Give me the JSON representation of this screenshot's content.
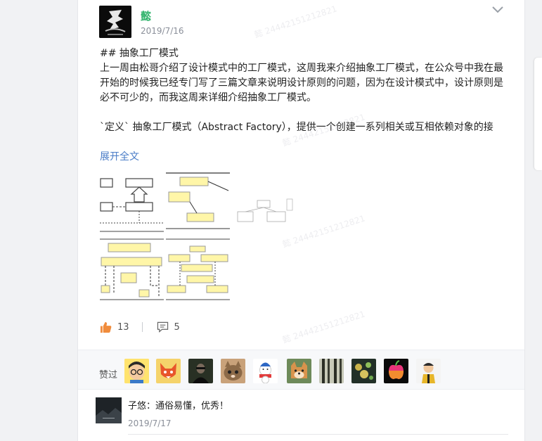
{
  "post": {
    "username": "懿",
    "date": "2019/7/16",
    "lines": [
      "## 抽象工厂模式",
      "上一周由松哥介绍了设计模式中的工厂模式，这周我来介绍抽象工厂模式，在公众号中我在最",
      "开始的时候我已经专门写了三篇文章来说明设计原则的问题，因为在设计模式中，设计原则是",
      "必不可少的，而我这周来详细介绍抽象工厂模式。",
      "",
      "`定义` 抽象工厂模式（Abstract Factory），提供一个创建一系列相关或互相依赖对象的接"
    ],
    "expand_label": "展开全文",
    "likes": "13",
    "comments": "5"
  },
  "likers": {
    "label": "赞过",
    "avatars": [
      "cartoon-glasses-avatar",
      "fox-avatar",
      "dark-figure-avatar",
      "cat-avatar",
      "snowman-avatar",
      "shiba-avatar",
      "forest-avatar",
      "lights-avatar",
      "apple-logo-avatar",
      "cartoon-man-avatar"
    ]
  },
  "comment": {
    "text": "子悠：通俗易懂，优秀！",
    "date": "2019/7/17"
  },
  "watermark": "懿 24442151212821",
  "colors": {
    "username": "#2fb36b",
    "link": "#4a7cc7",
    "like": "#f08c3c"
  }
}
